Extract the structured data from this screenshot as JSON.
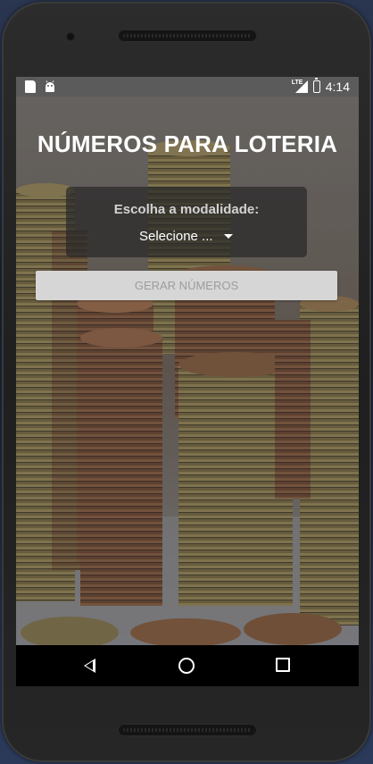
{
  "status_bar": {
    "time": "4:14",
    "network_label": "LTE",
    "left_icons": [
      "sd-card-icon",
      "android-debug-icon"
    ],
    "right_icons": [
      "signal-icon",
      "battery-charging-icon"
    ]
  },
  "app": {
    "title": "NÚMEROS PARA LOTERIA",
    "modality_panel": {
      "label": "Escolha a modalidade:",
      "select_value": "Selecione ..."
    },
    "generate_button_label": "GERAR NÚMEROS",
    "generate_button_enabled": false
  },
  "nav_bar": {
    "buttons": [
      "back-icon",
      "home-icon",
      "recents-icon"
    ]
  },
  "colors": {
    "status_bar": "#5b5b5b",
    "panel_bg": "#282828",
    "button_bg": "#d6d6d6",
    "button_text": "#9c9c9c",
    "title": "#ffffff"
  }
}
